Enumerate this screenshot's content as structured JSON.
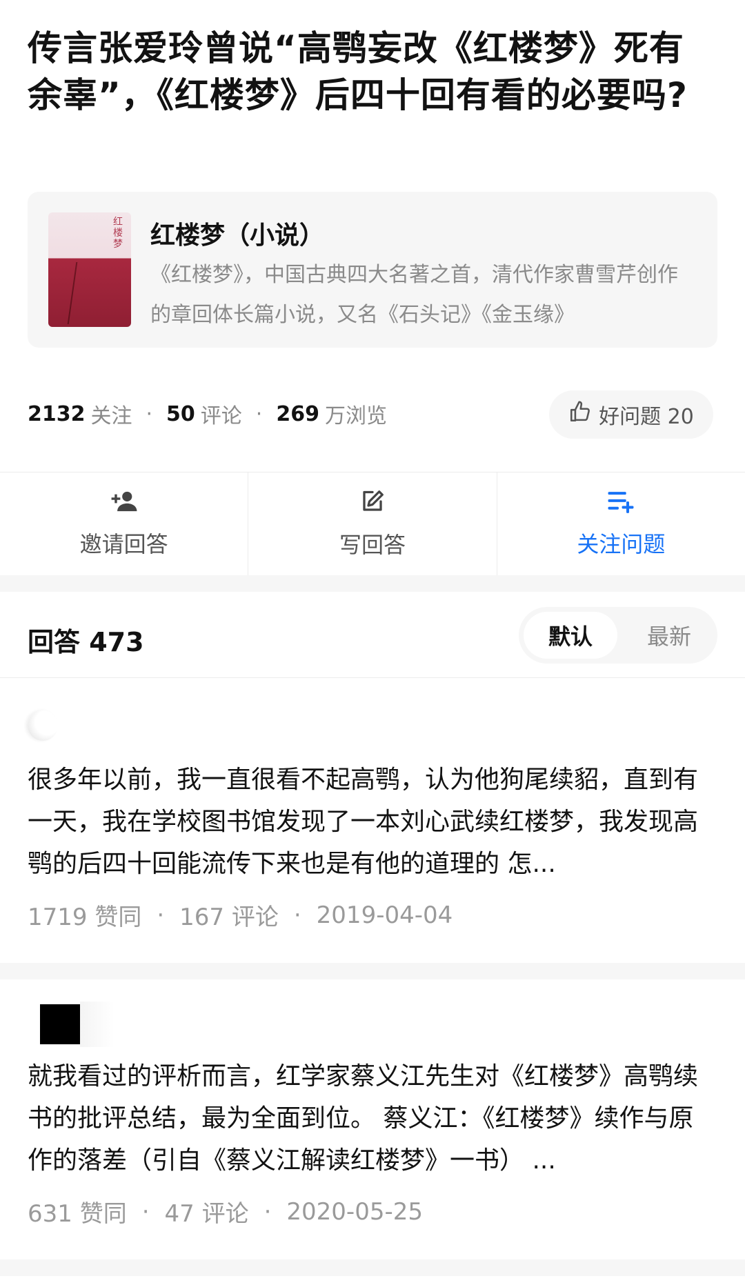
{
  "question": {
    "title": "传言张爱玲曾说“高鹗妄改《红楼梦》死有余辜”，《红楼梦》后四十回有看的必要吗?"
  },
  "topic": {
    "name": "红楼梦（小说）",
    "description": "《红楼梦》，中国古典四大名著之首，清代作家曹雪芹创作的章回体长篇小说，又名《石头记》《金玉缘》",
    "cover_title": "红楼梦"
  },
  "stats": {
    "follow_count": "2132",
    "follow_label": "关注",
    "comment_count": "50",
    "comment_label": "评论",
    "view_count": "269",
    "view_label": "万浏览",
    "separator": "·"
  },
  "good_question": {
    "label": "好问题 20",
    "icon": "thumbs-up-icon"
  },
  "actions": [
    {
      "label": "邀请回答",
      "icon": "add-user-icon"
    },
    {
      "label": "写回答",
      "icon": "edit-icon"
    },
    {
      "label": "关注问题",
      "icon": "follow-list-icon",
      "color": "#1772f6"
    }
  ],
  "answers": {
    "header": "回答 473",
    "sort_options": [
      "默认",
      "最新"
    ],
    "active_sort": "默认",
    "items": [
      {
        "text": "很多年以前，我一直很看不起高鹗，认为他狗尾续貂，直到有一天，我在学校图书馆发现了一本刘心武续红楼梦，我发现高鹗的后四十回能流传下来也是有他的道理的 怎...",
        "likes": "1719 赞同",
        "comments": "167 评论",
        "date": "2019-04-04"
      },
      {
        "text": "就我看过的评析而言，红学家蔡义江先生对《红楼梦》高鹗续书的批评总结，最为全面到位。 蔡义江：《红楼梦》续作与原作的落差（引自《蔡义江解读红楼梦》一书） ...",
        "likes": "631 赞同",
        "comments": "47 评论",
        "date": "2020-05-25"
      }
    ]
  },
  "colors": {
    "accent": "#1772f6",
    "muted_text": "#8a8a8a",
    "card_bg": "#f6f6f6"
  }
}
